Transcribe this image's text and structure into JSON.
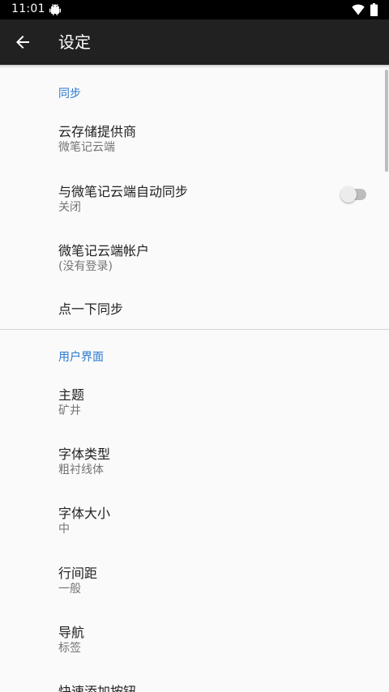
{
  "status_bar": {
    "time": "11:01",
    "icons": [
      "android-icon",
      "wifi-icon",
      "battery-icon"
    ]
  },
  "app_bar": {
    "back_icon": "arrow-back-icon",
    "title": "设定"
  },
  "sections": {
    "sync": {
      "header": "同步",
      "items": [
        {
          "title": "云存储提供商",
          "summary": "微笔记云端"
        },
        {
          "title": "与微笔记云端自动同步",
          "summary": "关闭",
          "toggle": false
        },
        {
          "title": "微笔记云端帐户",
          "summary": "(没有登录)"
        },
        {
          "title": "点一下同步"
        }
      ]
    },
    "ui": {
      "header": "用户界面",
      "items": [
        {
          "title": "主题",
          "summary": "矿井"
        },
        {
          "title": "字体类型",
          "summary": "粗衬线体"
        },
        {
          "title": "字体大小",
          "summary": "中"
        },
        {
          "title": "行间距",
          "summary": "一般"
        },
        {
          "title": "导航",
          "summary": "标签"
        },
        {
          "title": "快速添加按钮"
        }
      ]
    }
  },
  "colors": {
    "status_bar": "#000000",
    "app_bar": "#212121",
    "background": "#fafafa",
    "section_header": "#2a78d1",
    "title_text": "#212121",
    "summary_text": "#757575"
  }
}
